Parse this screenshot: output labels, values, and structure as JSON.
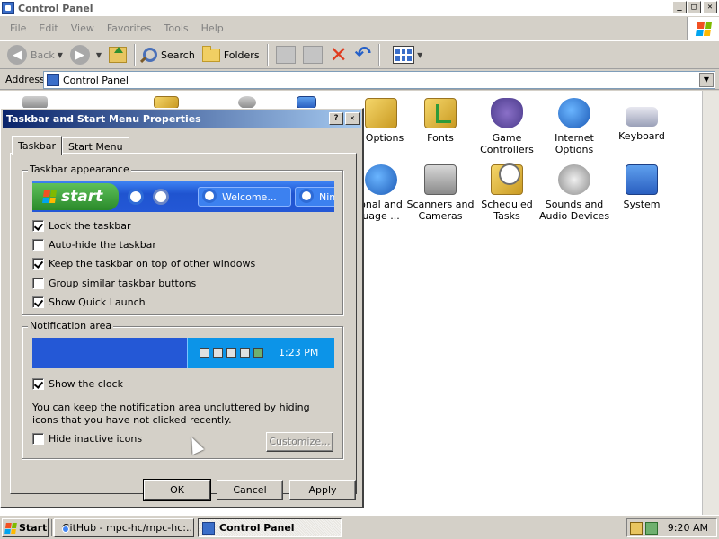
{
  "window": {
    "title": "Control Panel",
    "controls": {
      "minimize": "_",
      "maximize": "□",
      "close": "✕"
    }
  },
  "menu": [
    "File",
    "Edit",
    "View",
    "Favorites",
    "Tools",
    "Help"
  ],
  "toolbar": {
    "back_label": "Back",
    "search_label": "Search",
    "folders_label": "Folders",
    "icons": [
      "back-icon",
      "forward-icon",
      "up-folder-icon",
      "search-icon",
      "folders-icon",
      "move-to-icon",
      "copy-to-icon",
      "delete-icon",
      "undo-icon",
      "views-icon"
    ]
  },
  "address": {
    "label": "Address",
    "value": "Control Panel"
  },
  "content_icons": [
    {
      "label": "r Options",
      "icon": "regional-options-icon"
    },
    {
      "label": "Fonts",
      "icon": "fonts-folder-icon"
    },
    {
      "label": "Game Controllers",
      "icon": "game-controller-icon"
    },
    {
      "label": "Internet Options",
      "icon": "internet-globe-icon"
    },
    {
      "label": "Keyboard",
      "icon": "keyboard-icon"
    },
    {
      "label": "onal and uage ...",
      "icon": "regional-globe-icon"
    },
    {
      "label": "Scanners and Cameras",
      "icon": "scanner-camera-icon"
    },
    {
      "label": "Scheduled Tasks",
      "icon": "scheduled-tasks-icon"
    },
    {
      "label": "Sounds and Audio Devices",
      "icon": "speaker-icon"
    },
    {
      "label": "System",
      "icon": "system-computer-icon"
    }
  ],
  "dialog": {
    "title": "Taskbar and Start Menu Properties",
    "help": "?",
    "close": "✕",
    "tabs": [
      "Taskbar",
      "Start Menu"
    ],
    "appearance": {
      "heading": "Taskbar appearance",
      "preview": {
        "start": "start",
        "window1": "Welcome...",
        "window2": "Nin"
      },
      "options": [
        {
          "label": "Lock the taskbar",
          "checked": true
        },
        {
          "label": "Auto-hide the taskbar",
          "checked": false
        },
        {
          "label": "Keep the taskbar on top of other windows",
          "checked": true
        },
        {
          "label": "Group similar taskbar buttons",
          "checked": false
        },
        {
          "label": "Show Quick Launch",
          "checked": true
        }
      ]
    },
    "notification": {
      "heading": "Notification area",
      "preview_clock": "1:23 PM",
      "show_clock": {
        "label": "Show the clock",
        "checked": true
      },
      "note": "You can keep the notification area uncluttered by hiding icons that you have not clicked recently.",
      "hide_inactive": {
        "label": "Hide inactive icons",
        "checked": false
      },
      "customize": "Customize..."
    },
    "buttons": {
      "ok": "OK",
      "cancel": "Cancel",
      "apply": "Apply"
    }
  },
  "taskbar": {
    "start": "Start",
    "tasks": [
      {
        "label": "GitHub - mpc-hc/mpc-hc:...",
        "icon": "chrome-icon",
        "active": false
      },
      {
        "label": "Control Panel",
        "icon": "control-panel-icon",
        "active": true
      }
    ],
    "clock": "9:20 AM"
  }
}
